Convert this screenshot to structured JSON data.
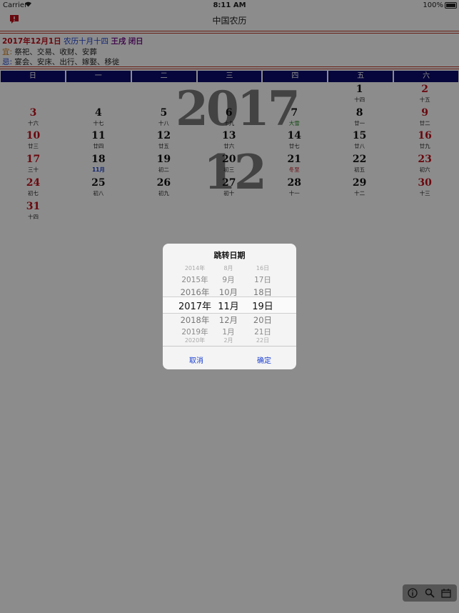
{
  "status_bar": {
    "carrier": "Carrier",
    "time": "8:11 AM",
    "battery": "100%"
  },
  "nav": {
    "title": "中国农历"
  },
  "info": {
    "date": "2017年12月1日",
    "lunar_date": "农历十月十四",
    "ganzhi": "王戌",
    "day_officer": "闭日",
    "yi_label": "宜:",
    "yi_text": "祭祀、交易、收财、安葬",
    "ji_label": "忌:",
    "ji_text": "宴会、安床、出行、嫁娶、移徙"
  },
  "weekdays": [
    "日",
    "一",
    "二",
    "三",
    "四",
    "五",
    "六"
  ],
  "watermark": {
    "year": "2017",
    "month": "12"
  },
  "calendar": {
    "first_weekday": 5,
    "days": [
      {
        "day": "1",
        "lunar": "十四"
      },
      {
        "day": "2",
        "lunar": "十五"
      },
      {
        "day": "3",
        "lunar": "十六"
      },
      {
        "day": "4",
        "lunar": "十七"
      },
      {
        "day": "5",
        "lunar": "十八"
      },
      {
        "day": "6",
        "lunar": "十九"
      },
      {
        "day": "7",
        "lunar": "大雪",
        "style": "term-green"
      },
      {
        "day": "8",
        "lunar": "廿一"
      },
      {
        "day": "9",
        "lunar": "廿二"
      },
      {
        "day": "10",
        "lunar": "廿三"
      },
      {
        "day": "11",
        "lunar": "廿四"
      },
      {
        "day": "12",
        "lunar": "廿五"
      },
      {
        "day": "13",
        "lunar": "廿六"
      },
      {
        "day": "14",
        "lunar": "廿七"
      },
      {
        "day": "15",
        "lunar": "廿八"
      },
      {
        "day": "16",
        "lunar": "廿九"
      },
      {
        "day": "17",
        "lunar": "三十"
      },
      {
        "day": "18",
        "lunar": "11月",
        "style": "month-blue"
      },
      {
        "day": "19",
        "lunar": "初二"
      },
      {
        "day": "20",
        "lunar": "初三"
      },
      {
        "day": "21",
        "lunar": "冬至",
        "style": "term-red"
      },
      {
        "day": "22",
        "lunar": "初五"
      },
      {
        "day": "23",
        "lunar": "初六"
      },
      {
        "day": "24",
        "lunar": "初七"
      },
      {
        "day": "25",
        "lunar": "初八"
      },
      {
        "day": "26",
        "lunar": "初九"
      },
      {
        "day": "27",
        "lunar": "初十"
      },
      {
        "day": "28",
        "lunar": "十一"
      },
      {
        "day": "29",
        "lunar": "十二"
      },
      {
        "day": "30",
        "lunar": "十三"
      },
      {
        "day": "31",
        "lunar": "十四"
      }
    ]
  },
  "dialog": {
    "title": "跳转日期",
    "years": [
      "2014年",
      "2015年",
      "2016年",
      "2017年",
      "2018年",
      "2019年",
      "2020年"
    ],
    "months": [
      "8月",
      "9月",
      "10月",
      "11月",
      "12月",
      "1月",
      "2月"
    ],
    "days": [
      "16日",
      "17日",
      "18日",
      "19日",
      "20日",
      "21日",
      "22日"
    ],
    "cancel_label": "取消",
    "ok_label": "确定"
  },
  "colors": {
    "accent_red": "#c0101a",
    "header_navy": "#0b0b6e",
    "link_blue": "#1a3fd0"
  },
  "icons": {
    "nav_left": "flag-icon",
    "toolbar": [
      "info-icon",
      "search-icon",
      "calendar-icon"
    ]
  }
}
